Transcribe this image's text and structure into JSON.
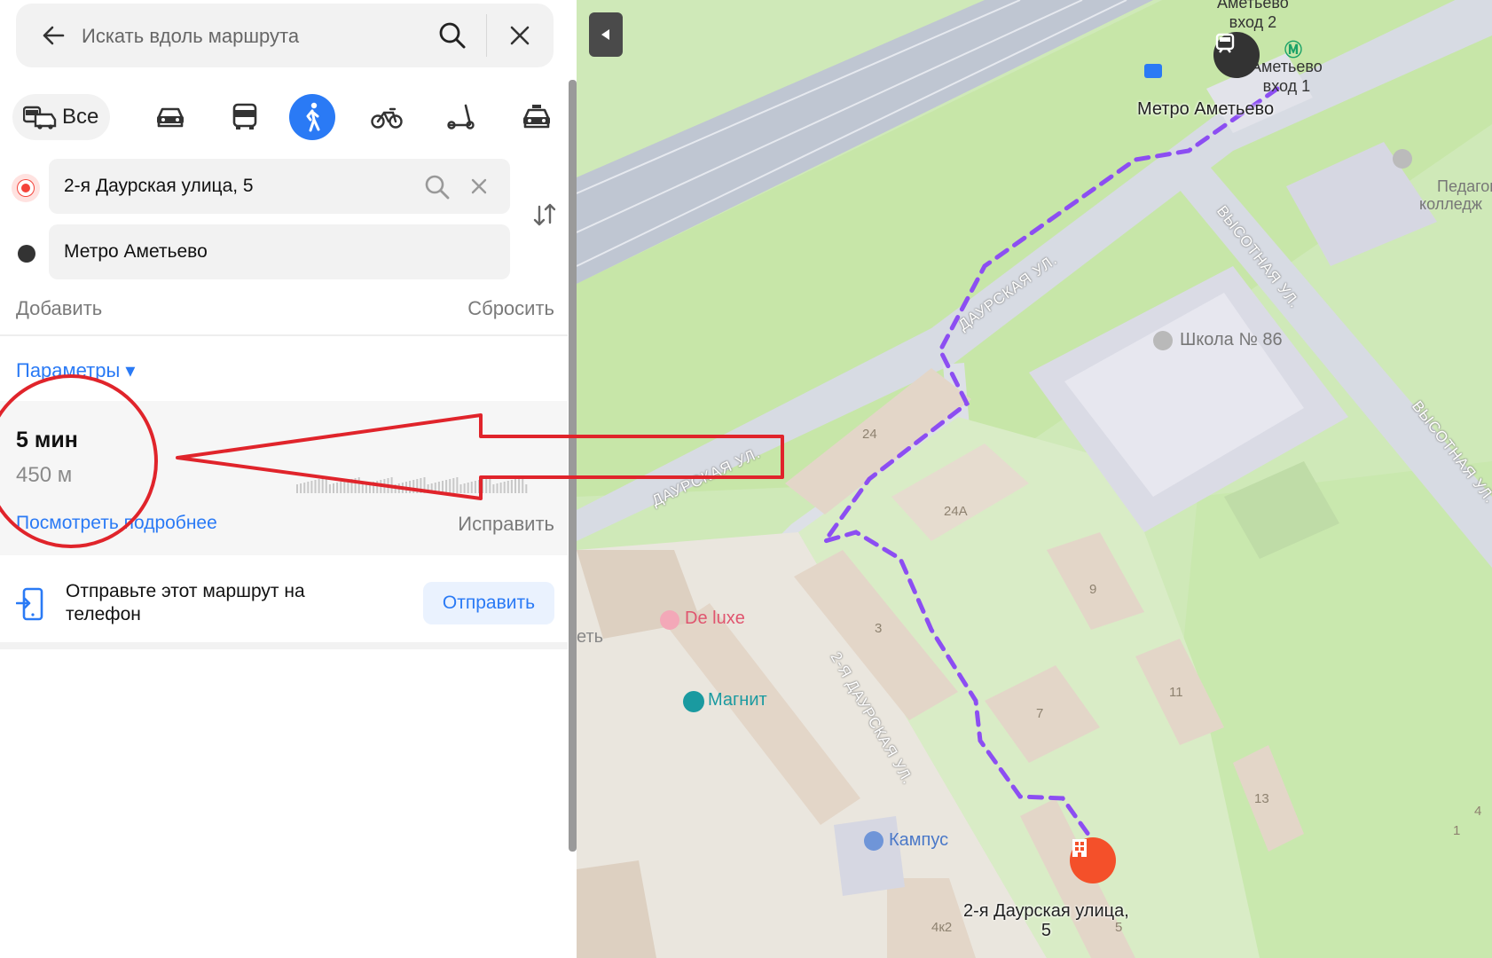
{
  "search": {
    "placeholder": "Искать вдоль маршрута"
  },
  "icons": {
    "back": "arrow-left-icon",
    "search": "magnifier-icon",
    "close": "close-icon",
    "swap": "swap-vertical-icon",
    "phone": "phone-send-icon",
    "collapse": "triangle-left-icon"
  },
  "modes": {
    "all_label": "Все",
    "items": [
      "all",
      "car",
      "bus",
      "walk",
      "bicycle",
      "scooter",
      "taxi"
    ],
    "selected": "walk"
  },
  "route": {
    "from": "2-я Даурская улица, 5",
    "to": "Метро Аметьево",
    "add_label": "Добавить",
    "reset_label": "Сбросить",
    "params_label": "Параметры ▾"
  },
  "result": {
    "duration": "5 мин",
    "distance": "450 м",
    "details_label": "Посмотреть подробнее",
    "fix_label": "Исправить"
  },
  "send": {
    "text": "Отправьте этот маршрут на телефон",
    "button_label": "Отправить"
  },
  "map": {
    "labels": {
      "metro_exit2": "Аметьево\nвход 2",
      "metro_exit1": "Аметьево\nвход 1",
      "metro_station": "Метро Аметьево",
      "college": "Педагогический\nколледж",
      "school": "Школа № 86",
      "deluxe": "De luxe",
      "magnit": "Магнит",
      "kampus": "Кампус",
      "destination": "2-я Даурская улица,\n5",
      "edge_fragment": "еть"
    },
    "streets": {
      "daurskaya_1": "ДАУРСКАЯ УЛ.",
      "daurskaya_2": "ДАУРСКАЯ УЛ.",
      "daurskaya_2nd": "2-Я ДАУРСКАЯ УЛ.",
      "vysotnaya_1": "ВЫСОТНАЯ УЛ.",
      "vysotnaya_2": "ВЫСОТНАЯ УЛ."
    },
    "house_numbers": [
      "24",
      "24А",
      "9",
      "3",
      "11",
      "7",
      "13",
      "4к2",
      "5",
      "4",
      "1"
    ],
    "colors": {
      "route": "#8c4ef2",
      "park": "#cfe9b8",
      "road": "#c9ced8",
      "building": "#e0d8cc",
      "annotation": "#e0242b"
    }
  }
}
